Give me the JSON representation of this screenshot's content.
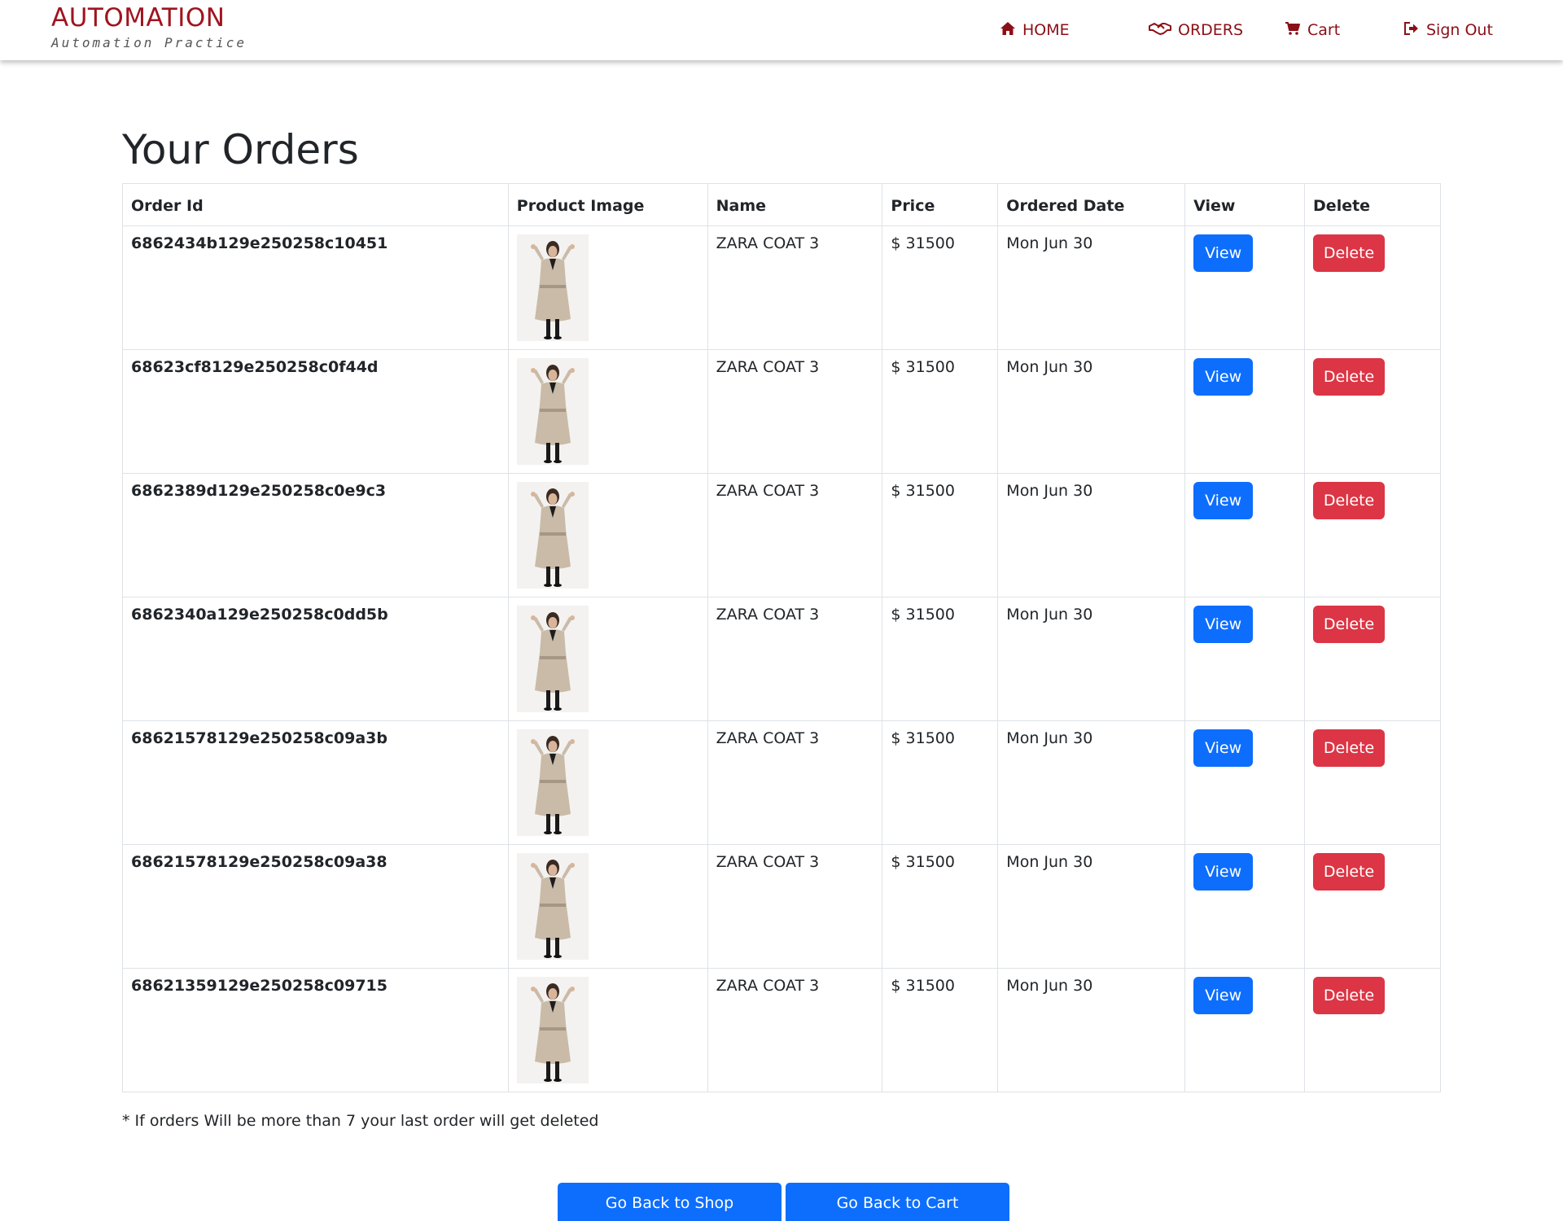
{
  "brand": {
    "title": "AUTOMATION",
    "subtitle": "Automation Practice"
  },
  "nav": {
    "home": {
      "label": "HOME",
      "icon": "home-icon"
    },
    "orders": {
      "label": "ORDERS",
      "icon": "handshake-icon"
    },
    "cart": {
      "label": "Cart",
      "icon": "cart-icon"
    },
    "signout": {
      "label": "Sign Out",
      "icon": "sign-out-icon"
    }
  },
  "colors": {
    "brand": "#a0141e",
    "nav": "#8b0f16",
    "primary": "#0d6efd",
    "danger": "#dc3545"
  },
  "main": {
    "title": "Your Orders",
    "columns": [
      "Order Id",
      "Product Image",
      "Name",
      "Price",
      "Ordered Date",
      "View",
      "Delete"
    ],
    "rows": [
      {
        "id": "6862434b129e250258c10451",
        "name": "ZARA COAT 3",
        "price": "$ 31500",
        "date": "Mon Jun 30",
        "view": "View",
        "delete": "Delete"
      },
      {
        "id": "68623cf8129e250258c0f44d",
        "name": "ZARA COAT 3",
        "price": "$ 31500",
        "date": "Mon Jun 30",
        "view": "View",
        "delete": "Delete"
      },
      {
        "id": "6862389d129e250258c0e9c3",
        "name": "ZARA COAT 3",
        "price": "$ 31500",
        "date": "Mon Jun 30",
        "view": "View",
        "delete": "Delete"
      },
      {
        "id": "6862340a129e250258c0dd5b",
        "name": "ZARA COAT 3",
        "price": "$ 31500",
        "date": "Mon Jun 30",
        "view": "View",
        "delete": "Delete"
      },
      {
        "id": "68621578129e250258c09a3b",
        "name": "ZARA COAT 3",
        "price": "$ 31500",
        "date": "Mon Jun 30",
        "view": "View",
        "delete": "Delete"
      },
      {
        "id": "68621578129e250258c09a38",
        "name": "ZARA COAT 3",
        "price": "$ 31500",
        "date": "Mon Jun 30",
        "view": "View",
        "delete": "Delete"
      },
      {
        "id": "68621359129e250258c09715",
        "name": "ZARA COAT 3",
        "price": "$ 31500",
        "date": "Mon Jun 30",
        "view": "View",
        "delete": "Delete"
      }
    ],
    "note": "* If orders Will be more than 7 your last order will get deleted",
    "back_to_shop": "Go Back to Shop",
    "back_to_cart": "Go Back to Cart"
  }
}
